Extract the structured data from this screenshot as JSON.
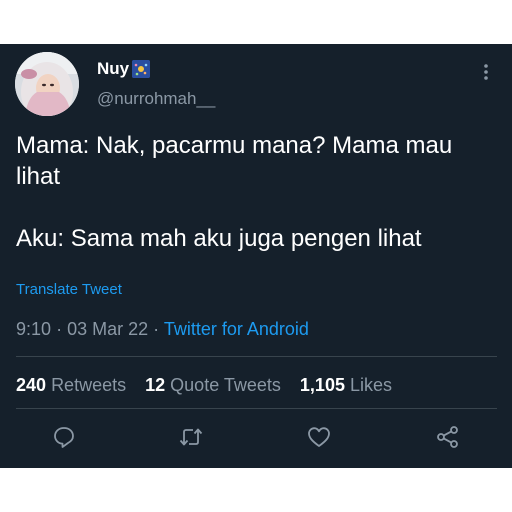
{
  "author": {
    "display_name": "Nuy",
    "handle": "@nurrohmah__"
  },
  "tweet": {
    "lines": [
      "Mama: Nak, pacarmu mana? Mama mau lihat",
      "Aku: Sama mah aku juga pengen lihat"
    ],
    "translate_label": "Translate Tweet",
    "time": "9:10",
    "date": "03 Mar 22",
    "source": "Twitter for Android",
    "separator": "·"
  },
  "stats": {
    "retweets_count": "240",
    "retweets_label": "Retweets",
    "quotes_count": "12",
    "quotes_label": "Quote Tweets",
    "likes_count": "1,105",
    "likes_label": "Likes"
  },
  "icons": {
    "more": "more-vertical-icon",
    "reply": "reply-icon",
    "retweet": "retweet-icon",
    "like": "heart-icon",
    "share": "share-icon"
  },
  "colors": {
    "background": "#15202b",
    "accent": "#1d9bf0",
    "secondary_text": "#8b98a5",
    "divider": "#38444d"
  }
}
